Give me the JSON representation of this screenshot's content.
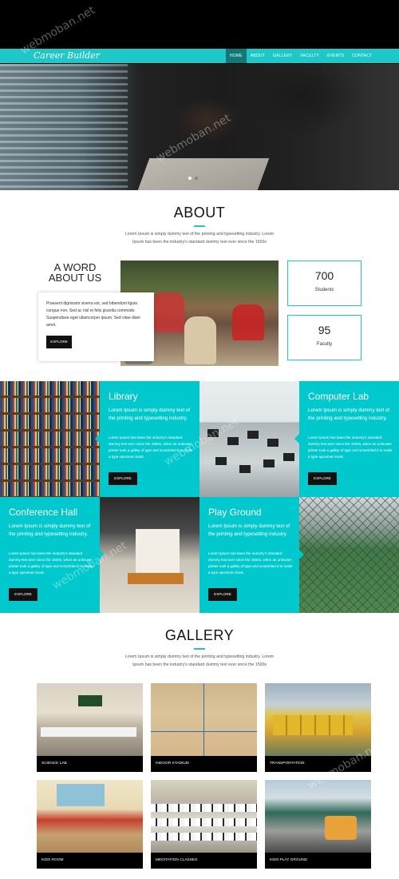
{
  "brand": "Career Builder",
  "nav": [
    "HOME",
    "ABOUT",
    "GALLERY",
    "FACULTY",
    "EVENTS",
    "CONTACT"
  ],
  "about": {
    "title": "ABOUT",
    "desc": "Lorem Ipsum is simply dummy text of the printing and typesetting industry. Lorem Ipsum has been the industry's standard dummy text ever since the 1500s",
    "word_title": "A WORD ABOUT US",
    "word_text": "Praesent dignissim viverra est, sed bibendum ligula congue non. Sed ac nisl et felis gravida commodo. Suspendisse eget ullamcorper ipsum. Sed vitae diam amet.",
    "explore": "EXPLORE",
    "stats": [
      {
        "num": "700",
        "label": "Students"
      },
      {
        "num": "95",
        "label": "Faculty"
      }
    ]
  },
  "facilities": [
    {
      "title": "Library",
      "lead": "Lorem Ipsum is simply dummy text of the printing and typesetting industry.",
      "body": "Lorem Ipsum has been the industry's standard dummy text ever since the 1500s, when an unknown printer took a galley of type and scrambled it to make a type specimen book.",
      "btn": "EXPLORE"
    },
    {
      "title": "Computer Lab",
      "lead": "Lorem Ipsum is simply dummy text of the printing and typesetting industry.",
      "body": "Lorem Ipsum has been the industry's standard dummy text ever since the 1500s, when an unknown printer took a galley of type and scrambled it to make a type specimen book.",
      "btn": "EXPLORE"
    },
    {
      "title": "Conference Hall",
      "lead": "Lorem Ipsum is simply dummy text of the printing and typesetting industry.",
      "body": "Lorem Ipsum has been the industry's standard dummy text ever since the 1500s, when an unknown printer took a galley of type and scrambled it to make a type specimen book.",
      "btn": "EXPLORE"
    },
    {
      "title": "Play Ground",
      "lead": "Lorem Ipsum is simply dummy text of the printing and typesetting industry.",
      "body": "Lorem Ipsum has been the industry's standard dummy text ever since the 1500s, when an unknown printer took a galley of type and scrambled it to make a type specimen book.",
      "btn": "EXPLORE"
    }
  ],
  "gallery": {
    "title": "GALLERY",
    "desc": "Lorem Ipsum is simply dummy text of the printing and typesetting industry. Lorem Ipsum has been the industry's standard dummy text ever since the 1500s",
    "items": [
      "SCIENCE LAB",
      "INDOOR STADIUM",
      "TRANSPORTATION",
      "KIDS ROOM",
      "MEDITATION CLASSES",
      "KIDS PLAY GROUND"
    ]
  },
  "colors": {
    "accent": "#1ec8c8",
    "teal": "#00c8cc",
    "active_nav": "#117777"
  },
  "watermark": "webmoban.net"
}
